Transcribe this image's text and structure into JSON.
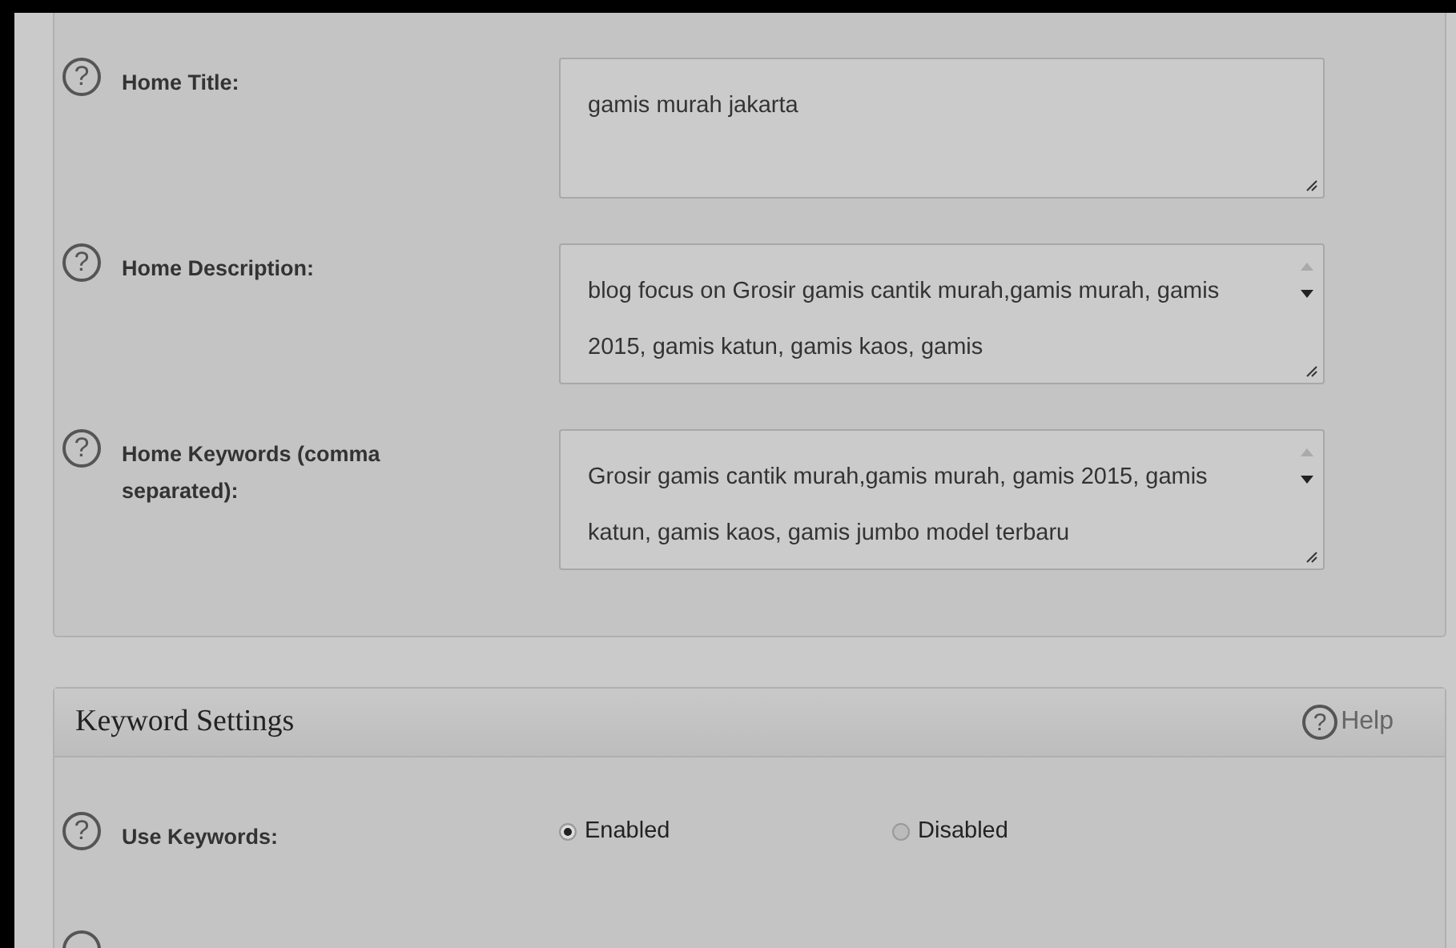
{
  "seo_fields": [
    {
      "label": "Home Title:",
      "value": "gamis murah jakarta",
      "scrollbar": false
    },
    {
      "label": "Home Description:",
      "value": "blog focus on Grosir gamis cantik murah,gamis murah, gamis 2015, gamis katun, gamis kaos, gamis",
      "scrollbar": true
    },
    {
      "label": "Home Keywords (comma separated):",
      "value": "Grosir gamis cantik murah,gamis murah, gamis 2015, gamis katun, gamis kaos, gamis jumbo model terbaru",
      "scrollbar": true
    }
  ],
  "keyword_settings": {
    "title": "Keyword Settings",
    "help": "Help",
    "icon": "?",
    "rows": [
      {
        "label": "Use Keywords:",
        "options": [
          {
            "label": "Enabled",
            "selected": true
          },
          {
            "label": "Disabled",
            "selected": false
          }
        ]
      }
    ]
  }
}
